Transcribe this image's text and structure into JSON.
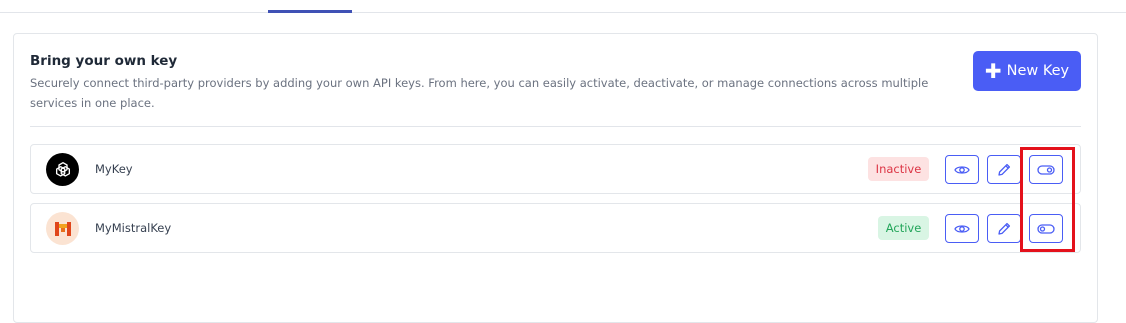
{
  "section": {
    "title": "Bring your own key",
    "description": "Securely connect third-party providers by adding your own API keys. From here, you can easily activate, deactivate, or manage connections across multiple services in one place.",
    "new_key_label": "New Key"
  },
  "keys": [
    {
      "name": "MyKey",
      "provider_icon": "openai-logo-icon",
      "status": "Inactive",
      "status_color": "#dc3545"
    },
    {
      "name": "MyMistralKey",
      "provider_icon": "mistral-logo-icon",
      "status": "Active",
      "status_color": "#23a55a"
    }
  ],
  "colors": {
    "accent": "#4a5df5",
    "highlight": "#e4111b"
  }
}
